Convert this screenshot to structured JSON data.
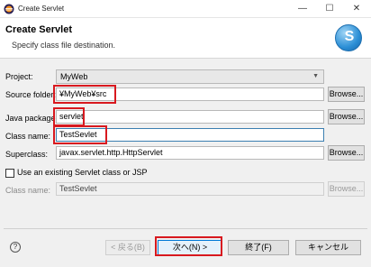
{
  "window": {
    "title": "Create Servlet",
    "minimize_glyph": "—",
    "maximize_glyph": "☐",
    "close_glyph": "✕"
  },
  "header": {
    "title": "Create Servlet",
    "description": "Specify class file destination.",
    "logo_letter": "S"
  },
  "form": {
    "project": {
      "label": "Project:",
      "value": "MyWeb"
    },
    "source_folder": {
      "label": "Source folder:",
      "value": "¥MyWeb¥src",
      "browse": "Browse..."
    },
    "java_package": {
      "label": "Java package:",
      "value": "servlet",
      "browse": "Browse..."
    },
    "class_name": {
      "label": "Class name:",
      "value": "TestSevlet"
    },
    "superclass": {
      "label": "Superclass:",
      "value": "javax.servlet.http.HttpServlet",
      "browse": "Browse..."
    },
    "existing_checkbox": {
      "label": "Use an existing Servlet class or JSP",
      "checked": false
    },
    "existing_class_name": {
      "label": "Class name:",
      "value": "TestSevlet",
      "browse": "Browse..."
    }
  },
  "footer": {
    "help_glyph": "?",
    "back_label": "< 戻る(B)",
    "next_label": "次へ(N) >",
    "finish_label": "終了(F)",
    "cancel_label": "キャンセル"
  },
  "colors": {
    "highlight": "#d8191f",
    "focus": "#0078d7"
  }
}
